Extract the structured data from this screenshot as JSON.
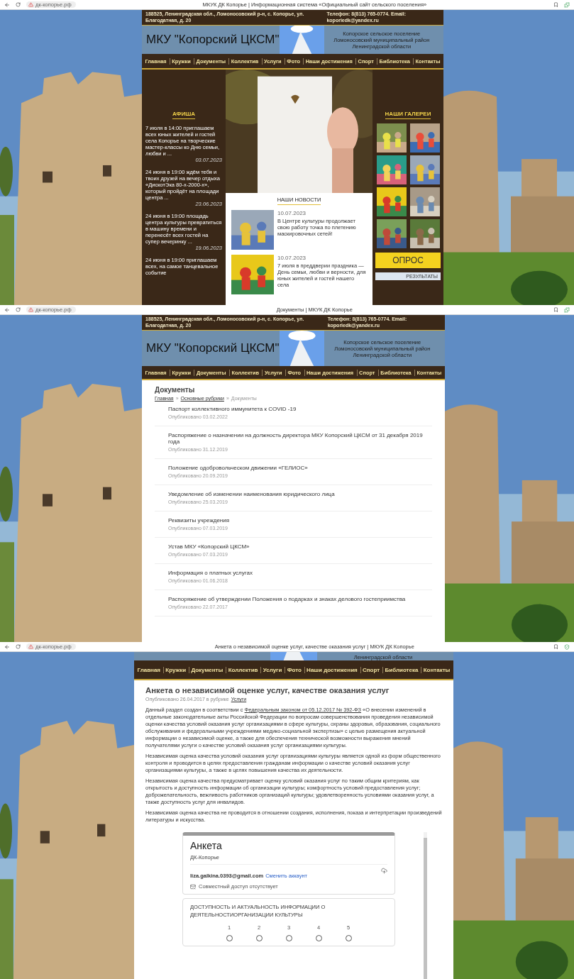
{
  "screens": [
    {
      "kind": "home",
      "browser": {
        "url": "дк-копорье.рф",
        "title": "МКУК ДК Копорье | Информационная система «Официальный сайт сельского поселения»"
      },
      "header": {
        "address": "188525, Ленинградская обл., Ломоносовский р-н, с. Копорье, ул. Благодатная, д. 20",
        "contacts": "Телефон: 8(813) 765-0774. Email: koporiedk@yandex.ru",
        "title": "МКУ \"Копорский ЦКСМ\"",
        "region": [
          "Копорское сельское поселение",
          "Ломоносовский муниципальный район",
          "Ленинградской области"
        ]
      },
      "nav": [
        "Главная",
        "Кружки",
        "Документы",
        "Коллектив",
        "Услуги",
        "Фото",
        "Наши достижения",
        "Спорт",
        "Библиотека",
        "Контакты"
      ],
      "afisha": {
        "title": "АФИША",
        "items": [
          {
            "text": "7 июля в 14:00 приглашаем всех юных жителей и гостей села Копорье на творческие мастер-классы ко Дню семьи, любви и ...",
            "date": "03.07.2023"
          },
          {
            "text": "24 июня в 19:00 ждём тебя и твоих друзей на вечер отдыха «ДискотЭка 80-х-2000-х», который пройдёт на площади центра ...",
            "date": "23.06.2023"
          },
          {
            "text": "24 июня в 19:00 площадь центра культуры превратиться в машину времени и перенесёт всех гостей на супер вечеринку ...",
            "date": "19.06.2023"
          },
          {
            "text": "24 июня в 19:00 приглашаем всех, на самое танцевальное событие"
          }
        ]
      },
      "news": {
        "title": "НАШИ НОВОСТИ",
        "items": [
          {
            "date": "10.07.2023",
            "text": "В Центре культуры продолжает свою работу точка по плетению маскировочных сетей!"
          },
          {
            "date": "10.07.2023",
            "text": "7 июля в преддверии праздника — День семьи, любви и верности, для юных жителей и гостей нашего села"
          }
        ]
      },
      "gallery": {
        "title": "НАШИ ГАЛЕРЕИ"
      },
      "survey": {
        "button": "ОПРОС",
        "results": "РЕЗУЛЬТАТЫ"
      }
    },
    {
      "kind": "documents",
      "browser": {
        "url": "дк-копорье.рф",
        "title": "Документы | МКУК ДК Копорье"
      },
      "header": {
        "address": "188525, Ленинградская обл., Ломоносовский р-н, с. Копорье, ул. Благодатная, д. 20",
        "contacts": "Телефон: 8(813) 765-0774. Email: koporiedk@yandex.ru",
        "title": "МКУ \"Копорский ЦКСМ\"",
        "region": [
          "Копорское сельское поселение",
          "Ломоносовский муниципальный район",
          "Ленинградской области"
        ]
      },
      "nav": [
        "Главная",
        "Кружки",
        "Документы",
        "Коллектив",
        "Услуги",
        "Фото",
        "Наши достижения",
        "Спорт",
        "Библиотека",
        "Контакты"
      ],
      "title": "Документы",
      "breadcrumb": [
        {
          "kind": "link",
          "text": "Главная"
        },
        {
          "kind": "separator",
          "text": "»"
        },
        {
          "kind": "link",
          "text": "Основные рубрики"
        },
        {
          "kind": "separator",
          "text": "»"
        },
        {
          "kind": "current",
          "text": "Документы"
        }
      ],
      "documents": [
        {
          "title": "Паспорт коллективного иммунитета к COVID -19",
          "date": "Опубликовано 03.02.2022"
        },
        {
          "title": "Распоряжение о назначении на должность директора МКУ Копорский ЦКСМ от 31 декабря 2019 года",
          "date": "Опубликовано 31.12.2019"
        },
        {
          "title": "Положение одобровольческом движении «ГЕЛИОС»",
          "date": "Опубликовано 20.09.2019"
        },
        {
          "title": "Уведомление об изменении наименования юридического лица",
          "date": "Опубликовано 25.03.2019"
        },
        {
          "title": "Реквизиты учреждения",
          "date": "Опубликовано 07.03.2019"
        },
        {
          "title": "Устав МКУ «Копорский ЦКСМ»",
          "date": "Опубликовано 07.03.2019"
        },
        {
          "title": "Информация о платных услугах",
          "date": "Опубликовано 01.06.2018"
        },
        {
          "title": "Распоряжение об утверждении Положения о подарках и знаках делового гостеприимства",
          "date": "Опубликовано 22.07.2017"
        }
      ]
    },
    {
      "kind": "article",
      "browser": {
        "url": "дк-копорье.рф",
        "title": "Анкета о независимой оценке услуг, качестве оказания услуг | МКУК ДК Копорье"
      },
      "header": {
        "region": [
          "Ленинградской области"
        ]
      },
      "nav": [
        "Главная",
        "Кружки",
        "Документы",
        "Коллектив",
        "Услуги",
        "Фото",
        "Наши достижения",
        "Спорт",
        "Библиотека",
        "Контакты"
      ],
      "title": "Анкета о независимой оценке услуг, качестве оказания услуг",
      "meta": {
        "text": "Опубликовано 26.04.2017 в рубрике",
        "link": "Услуги"
      },
      "paragraphs": [
        {
          "before": "Данный раздел создан в соответствии с",
          "link": "Федеральным законом от 05.12.2017 № 392-ФЗ",
          "after": "«О внесении изменений в отдельные законодательные акты Российской Федерации по вопросам совершенствования проведения независимой оценки качества условий оказания услуг организациями в сфере культуры, охраны здоровья, образования, социального обслуживания и федеральными учреждениями медико-социальной экспертизы» с целью размещения актуальной информации о независимой оценке, а также для обеспечения технической возможности выражения мнений получателями услуги о качестве условий оказания услуг организациями культуры."
        },
        {
          "before": "Независимая оценка качества условий оказания услуг организациями культуры является одной из форм общественного контроля и проводится в целях предоставления гражданам информации о качестве условий оказания услуг организациями культуры, а также в целях повышения качества их деятельности."
        },
        {
          "before": "Независимая оценка качества предусматривает оценку условий оказания услуг по таким общим критериям, как открытость и доступность информации об организации культуры; комфортность условий предоставления услуг; доброжелательность, вежливость работников организаций культуры; удовлетворенность условиями оказания услуг, а также доступность услуг для инвалидов."
        },
        {
          "before": "Независимая оценка качества не проводится в отношении создания, исполнения, показа и интерпретации произведений литературы и искусства."
        }
      ],
      "form": {
        "title": "Анкета",
        "subtitle": "ДК-Копорье",
        "email": "liza.galkina.0393@gmail.com",
        "switch": "Сменить аккаунт",
        "sharing": "Совместный доступ отсутствует",
        "question": "ДОСТУПНОСТЬ И АКТУАЛЬНОСТЬ ИНФОРМАЦИИ О ДЕЯТЕЛЬНОСТИОРГАНИЗАЦИИ КУЛЬТУРЫ",
        "scale": [
          {
            "label": "1",
            "selected": false
          },
          {
            "label": "2",
            "selected": false
          },
          {
            "label": "3",
            "selected": false
          },
          {
            "label": "4",
            "selected": false
          },
          {
            "label": "5",
            "selected": false
          }
        ]
      }
    }
  ]
}
